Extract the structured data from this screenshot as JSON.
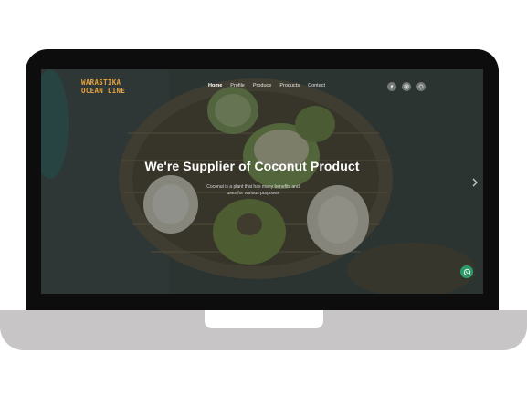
{
  "brand": {
    "line1": "WARASTIKA",
    "line2": "OCEAN LINE",
    "color": "#e8a23a"
  },
  "nav": {
    "items": [
      {
        "label": "Home",
        "active": true
      },
      {
        "label": "Profile",
        "active": false
      },
      {
        "label": "Produce",
        "active": false
      },
      {
        "label": "Products",
        "active": false
      },
      {
        "label": "Contact",
        "active": false
      }
    ]
  },
  "socials": [
    {
      "icon": "facebook-icon"
    },
    {
      "icon": "instagram-icon"
    },
    {
      "icon": "whatsapp-icon"
    }
  ],
  "hero": {
    "title": "We're Supplier of Coconut Product",
    "subtitle_line1": "Coconut is a plant that has many benefits and",
    "subtitle_line2": "uses for various purposes"
  },
  "slider": {
    "next_icon": "chevron-right-icon"
  },
  "floating": {
    "icon": "whatsapp-icon",
    "color": "#2c9a6a"
  }
}
